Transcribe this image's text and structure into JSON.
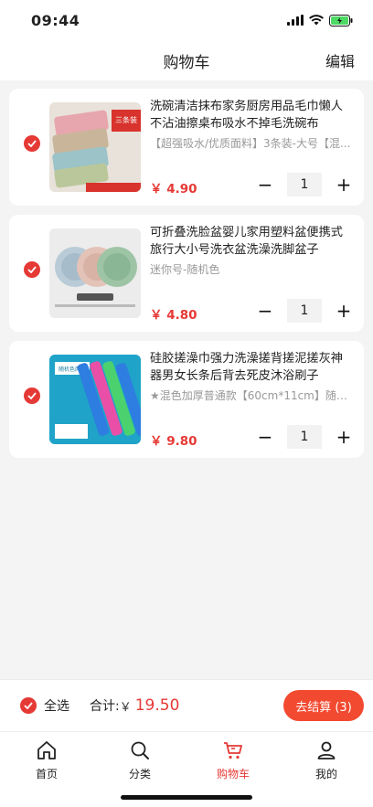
{
  "status": {
    "time": "09:44"
  },
  "nav": {
    "title": "购物车",
    "edit_label": "编辑"
  },
  "items": [
    {
      "title": "洗碗清洁抹布家务厨房用品毛巾懒人不沾油擦桌布吸水不掉毛洗碗布",
      "spec": "【超强吸水/优质面料】3条装-大号【混...",
      "price": "￥ 4.90",
      "qty": "1",
      "thumb_text": "三条装"
    },
    {
      "title": "可折叠洗脸盆婴儿家用塑料盆便携式旅行大小号洗衣盆洗澡洗脚盆子",
      "spec": "迷你号-随机色",
      "price": "￥ 4.80",
      "qty": "1"
    },
    {
      "title": "硅胶搓澡巾强力洗澡搓背搓泥搓灰神器男女长条后背去死皮沐浴刷子",
      "spec": "★混色加厚普通款【60cm*11cm】随机...",
      "price": "￥ 9.80",
      "qty": "1",
      "thumb_text": "随机色两条"
    }
  ],
  "checkout": {
    "select_all_label": "全选",
    "total_label": "合计:",
    "currency": "￥",
    "total_value": "19.50",
    "button_label": "去结算 (3)"
  },
  "tabs": [
    {
      "label": "首页",
      "icon": "home-icon"
    },
    {
      "label": "分类",
      "icon": "search-icon"
    },
    {
      "label": "购物车",
      "icon": "cart-icon",
      "active": true
    },
    {
      "label": "我的",
      "icon": "user-icon"
    }
  ],
  "colors": {
    "accent": "#e53935",
    "checkout_button": "#f24a30"
  }
}
